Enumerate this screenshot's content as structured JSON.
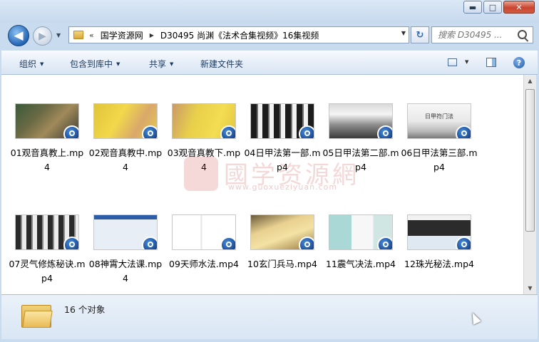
{
  "window": {
    "minimize": "▬",
    "maximize": "□",
    "close": "✕"
  },
  "nav": {
    "back": "◀",
    "forward": "▶",
    "history": "▼"
  },
  "address": {
    "overflow": "«",
    "crumbs": [
      "国学资源网",
      "D30495 尚渊《法术合集视频》16集视频"
    ],
    "separator": "▶",
    "dropdown": "▼"
  },
  "refresh_symbol": "↻",
  "search": {
    "placeholder": "搜索 D30495 ..."
  },
  "toolbar": {
    "organize": "组织",
    "include_library": "包含到库中",
    "share": "共享",
    "new_folder": "新建文件夹",
    "caret": "▼",
    "help": "?"
  },
  "files": [
    {
      "label": "01观音真教上.mp4",
      "thumb": "hand-dark"
    },
    {
      "label": "02观音真教中.mp4",
      "thumb": "hand-yellow"
    },
    {
      "label": "03观音真教下.mp4",
      "thumb": "hand-yellow2"
    },
    {
      "label": "04日甲法第一部.mp4",
      "thumb": "slide-corridor"
    },
    {
      "label": "05日甲法第二部.mp4",
      "thumb": "landscape-dark"
    },
    {
      "label": "06日甲法第三部.mp4",
      "thumb": "landscape-title"
    },
    {
      "label": "07灵气修炼秘诀.mp4",
      "thumb": "slide-corridor2"
    },
    {
      "label": "08神霄大法课.mp4",
      "thumb": "desktop-corridor"
    },
    {
      "label": "09天师水法.mp4",
      "thumb": "document"
    },
    {
      "label": "10玄门兵马.mp4",
      "thumb": "warm-blur"
    },
    {
      "label": "11震气决法.mp4",
      "thumb": "figure-slide"
    },
    {
      "label": "12珠光秘法.mp4",
      "thumb": "app-window"
    }
  ],
  "thumb_caption_06": "日甲符门法",
  "watermark": {
    "text": "國学资源網",
    "url": "www.guoxueziyuan.com",
    "seal": "国"
  },
  "status": {
    "count": "16 个对象"
  },
  "scroll": {
    "up": "▲",
    "down": "▼"
  }
}
